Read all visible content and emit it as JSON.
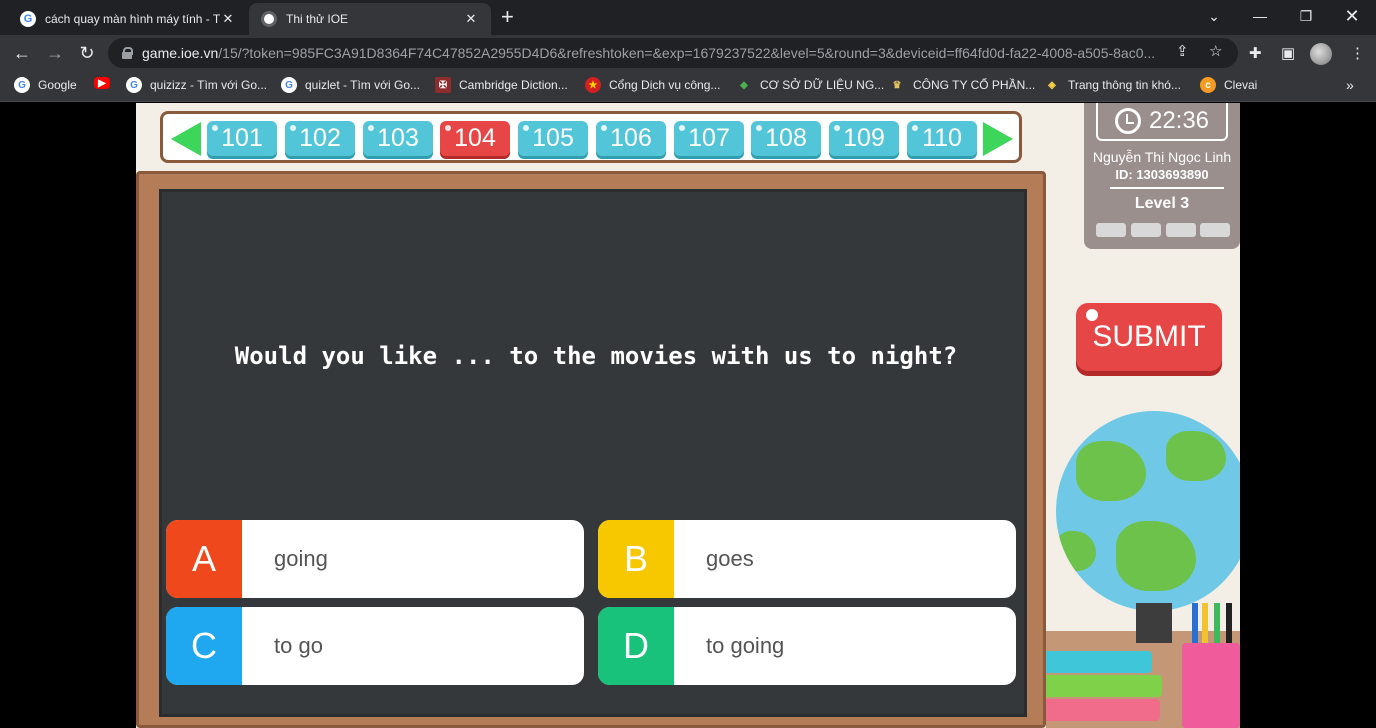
{
  "browser": {
    "tabs": [
      {
        "title": "cách quay màn hình máy tính - Tìm",
        "active": false
      },
      {
        "title": "Thi thử IOE",
        "active": true
      }
    ],
    "url_host": "game.ioe.vn",
    "url_path": "/15/?token=985FC3A91D8364F74C47852A2955D4D6&refreshtoken=&exp=1679237522&level=5&round=3&deviceid=ff64fd0d-fa22-4008-a505-8ac0...",
    "bookmarks": [
      {
        "label": "Google",
        "icon": "google-icon"
      },
      {
        "label": "",
        "icon": "youtube-icon"
      },
      {
        "label": "quizizz - Tìm với Go...",
        "icon": "google-icon"
      },
      {
        "label": "quizlet - Tìm với Go...",
        "icon": "google-icon"
      },
      {
        "label": "Cambridge Diction...",
        "icon": "cambridge-icon"
      },
      {
        "label": "Cổng Dịch vụ công...",
        "icon": "emblem-icon"
      },
      {
        "label": "CƠ SỞ DỮ LIỆU NG...",
        "icon": "database-icon"
      },
      {
        "label": "CÔNG TY CỔ PHẦN...",
        "icon": "company-icon"
      },
      {
        "label": "Trang thông tin khó...",
        "icon": "info-icon"
      },
      {
        "label": "Clevai",
        "icon": "clevai-icon"
      }
    ],
    "more_bookmarks": "»"
  },
  "game": {
    "question_numbers": [
      "101",
      "102",
      "103",
      "104",
      "105",
      "106",
      "107",
      "108",
      "109",
      "110"
    ],
    "active_question": "104",
    "timer": "22:36",
    "player_name": "Nguyễn Thị Ngọc  Linh",
    "player_id": "ID: 1303693890",
    "level": "Level 3",
    "submit_label": "SUBMIT",
    "question": "Would you like ... to the movies with us to night?",
    "answers": [
      {
        "letter": "A",
        "text": "going",
        "color": "#f0481d"
      },
      {
        "letter": "B",
        "text": "goes",
        "color": "#f7c800"
      },
      {
        "letter": "C",
        "text": "to go",
        "color": "#1fa8f0"
      },
      {
        "letter": "D",
        "text": "to going",
        "color": "#18c27a"
      }
    ]
  },
  "colors": {
    "question_button": "#52c6d8",
    "active_question_button": "#e74646",
    "chalkboard": "#34383a",
    "frame": "#b47d57"
  }
}
